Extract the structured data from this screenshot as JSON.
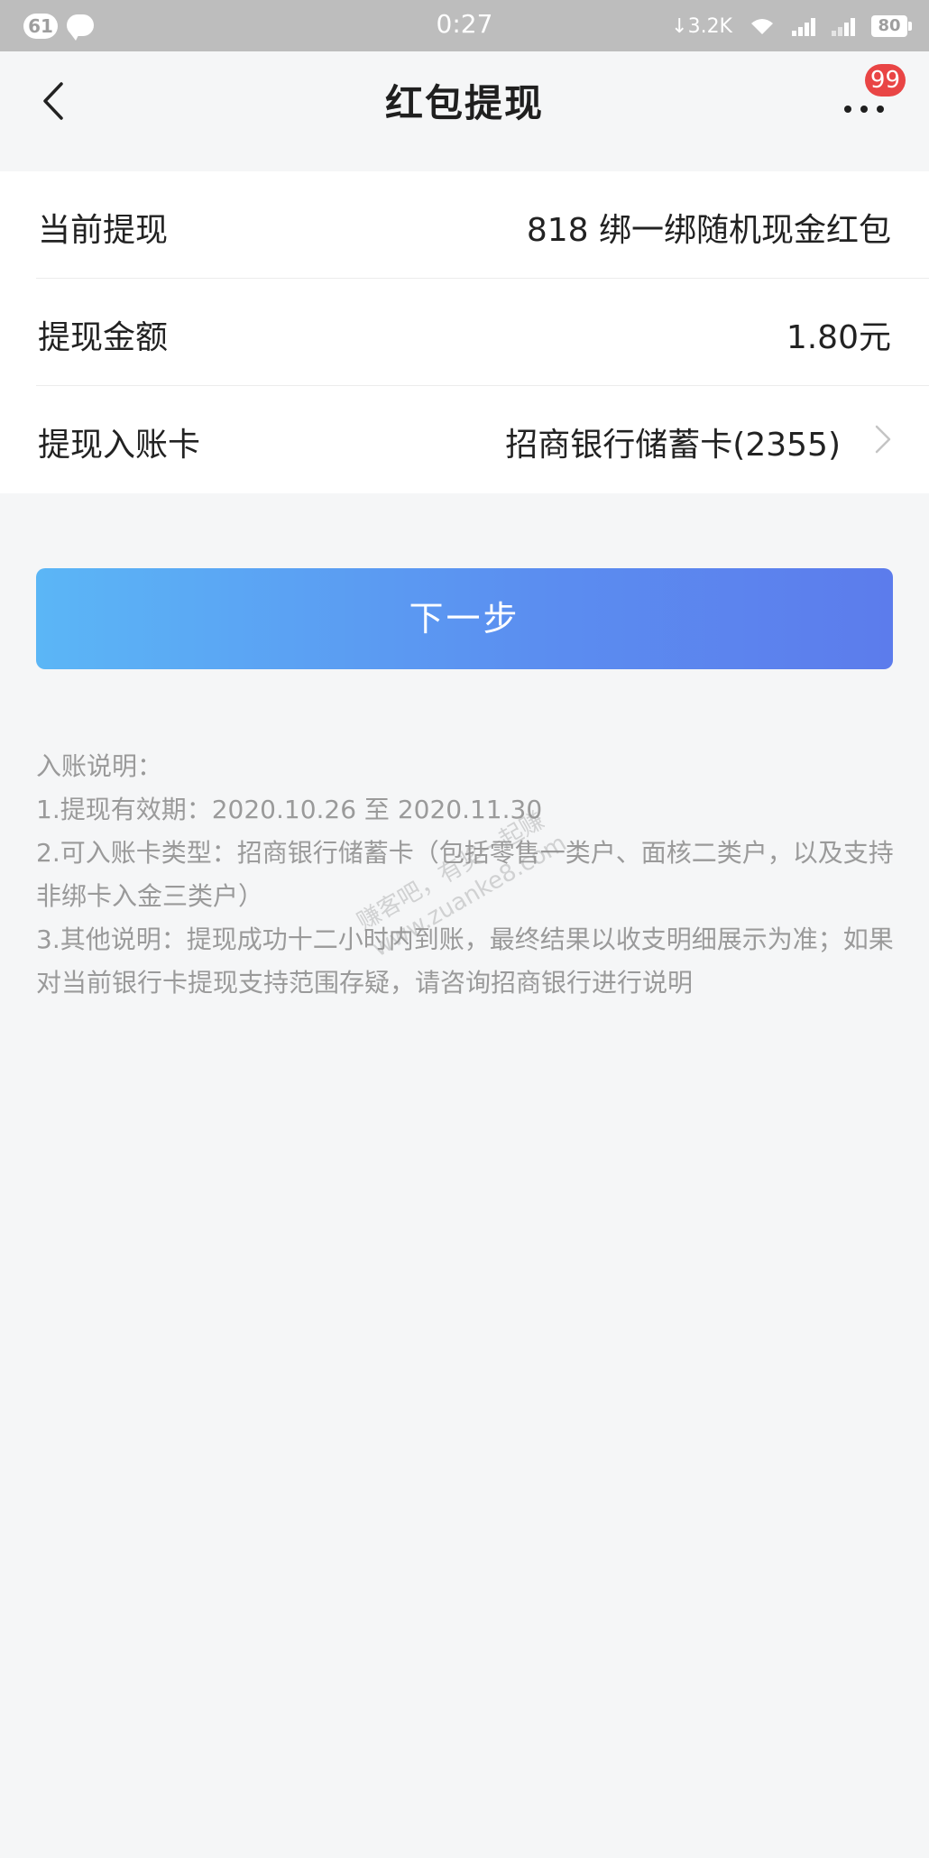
{
  "status_bar": {
    "notification_count": "61",
    "time": "0:27",
    "network_speed": "↓3.2K",
    "battery": "80"
  },
  "nav": {
    "title": "红包提现",
    "more_badge": "99"
  },
  "info": {
    "rows": [
      {
        "label": "当前提现",
        "value": "818 绑一绑随机现金红包"
      },
      {
        "label": "提现金额",
        "value": "1.80元"
      },
      {
        "label": "提现入账卡",
        "value": "招商银行储蓄卡(2355)"
      }
    ]
  },
  "actions": {
    "next_label": "下一步"
  },
  "notes": {
    "title": "入账说明：",
    "lines": [
      "1.提现有效期：2020.10.26 至 2020.11.30",
      "2.可入账卡类型：招商银行储蓄卡（包括零售一类户、面核二类户，以及支持非绑卡入金三类户）",
      "3.其他说明：提现成功十二小时内到账，最终结果以收支明细展示为准；如果对当前银行卡提现支持范围存疑，请咨询招商银行进行说明"
    ]
  },
  "watermark": {
    "line1": "赚客吧，有奖一起赚",
    "line2": "www.zuanke8.com"
  },
  "colors": {
    "button_gradient_start": "#5bb6f6",
    "button_gradient_end": "#5c7cec",
    "badge_red": "#e94545",
    "background": "#f5f6f7"
  }
}
